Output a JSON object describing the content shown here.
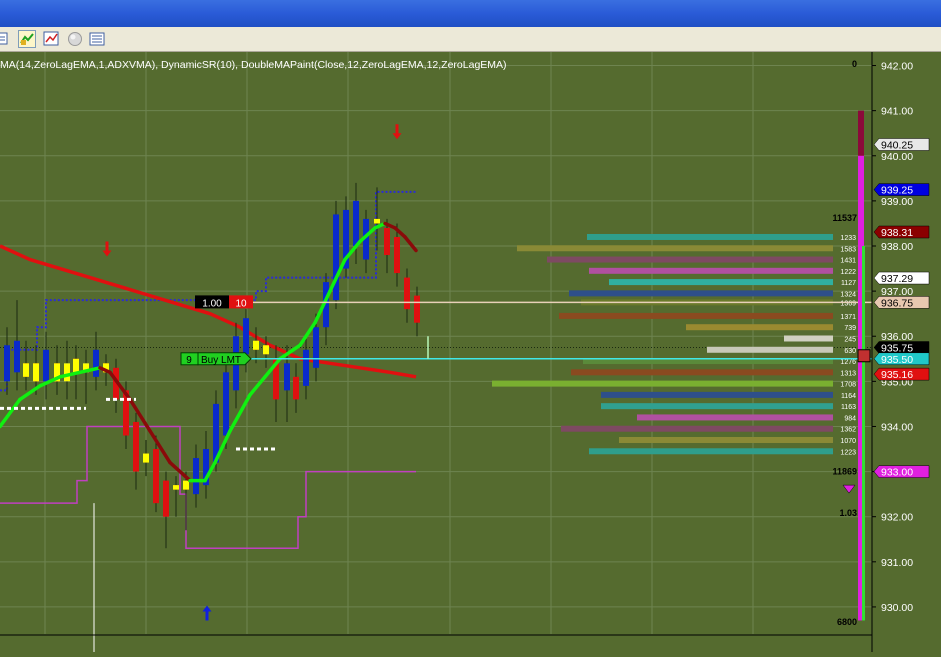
{
  "indicators_label": "MA(14,ZeroLagEMA,1,ADXVMA), DynamicSR(10), DoubleMAPaint(Close,12,ZeroLagEMA,12,ZeroLagEMA)",
  "colors": {
    "background": "#556b2f",
    "grid": "#6e8450",
    "bull": "#0a2acc",
    "bear": "#e01010",
    "doji": "#ffff00",
    "ma_up": "#10f010",
    "ma_down": "#8a0a0a",
    "slow_ma": "#e01010",
    "resistance": "#2a2ad8",
    "support": "#c040c0"
  },
  "chart_data": {
    "type": "candlestick",
    "ylim": [
      929.4,
      942.3
    ],
    "y_ticks": [
      "942.00",
      "941.00",
      "940.00",
      "939.00",
      "938.00",
      "937.00",
      "936.00",
      "935.00",
      "934.00",
      "933.00",
      "932.00",
      "931.00",
      "930.00"
    ],
    "y_tick_values": [
      942,
      941,
      940,
      939,
      938,
      937,
      936,
      935,
      934,
      933,
      932,
      931,
      930
    ],
    "price_flags": [
      {
        "label": "940.25",
        "value": 940.25,
        "bg": "#e8e8e8",
        "fg": "#000000"
      },
      {
        "label": "939.25",
        "value": 939.25,
        "bg": "#0000e0",
        "fg": "#ffffff"
      },
      {
        "label": "938.31",
        "value": 938.31,
        "bg": "#8b0000",
        "fg": "#ffffff"
      },
      {
        "label": "937.29",
        "value": 937.29,
        "bg": "#ffffff",
        "fg": "#000000"
      },
      {
        "label": "936.75",
        "value": 936.75,
        "bg": "#e8c8b0",
        "fg": "#000000"
      },
      {
        "label": "935.75",
        "value": 935.75,
        "bg": "#000000",
        "fg": "#ffffff"
      },
      {
        "label": "935.50",
        "value": 935.5,
        "bg": "#20c8c8",
        "fg": "#ffffff"
      },
      {
        "label": "935.16",
        "value": 935.16,
        "bg": "#e01010",
        "fg": "#ffffff"
      },
      {
        "label": "933.00",
        "value": 933.0,
        "bg": "#e020e0",
        "fg": "#ffffff"
      }
    ],
    "candles": [
      {
        "x": 7,
        "o": 935.0,
        "c": 935.8,
        "h": 936.2,
        "l": 934.7
      },
      {
        "x": 17,
        "o": 935.2,
        "c": 935.9,
        "h": 936.8,
        "l": 934.8
      },
      {
        "x": 26,
        "o": 935.4,
        "c": 935.1,
        "h": 935.9,
        "l": 934.8
      },
      {
        "x": 36,
        "o": 935.4,
        "c": 935.0,
        "h": 935.8,
        "l": 934.7
      },
      {
        "x": 46,
        "o": 935.0,
        "c": 935.7,
        "h": 936.1,
        "l": 934.6
      },
      {
        "x": 57,
        "o": 935.4,
        "c": 935.0,
        "h": 935.8,
        "l": 934.7
      },
      {
        "x": 67,
        "o": 935.0,
        "c": 935.4,
        "h": 935.9,
        "l": 934.6
      },
      {
        "x": 76,
        "o": 935.5,
        "c": 935.2,
        "h": 935.8,
        "l": 934.6
      },
      {
        "x": 86,
        "o": 935.2,
        "c": 935.4,
        "h": 935.7,
        "l": 934.5
      },
      {
        "x": 96,
        "o": 935.1,
        "c": 935.7,
        "h": 936.1,
        "l": 934.8
      },
      {
        "x": 106,
        "o": 935.4,
        "c": 935.2,
        "h": 935.6,
        "l": 934.9
      },
      {
        "x": 116,
        "o": 935.3,
        "c": 934.6,
        "h": 935.5,
        "l": 934.3
      },
      {
        "x": 126,
        "o": 934.8,
        "c": 933.8,
        "h": 935.0,
        "l": 933.5
      },
      {
        "x": 136,
        "o": 934.1,
        "c": 933.0,
        "h": 934.3,
        "l": 932.6
      },
      {
        "x": 146,
        "o": 933.4,
        "c": 933.2,
        "h": 933.7,
        "l": 932.9
      },
      {
        "x": 156,
        "o": 933.5,
        "c": 932.3,
        "h": 933.8,
        "l": 932.1
      },
      {
        "x": 166,
        "o": 932.8,
        "c": 932.0,
        "h": 933.0,
        "l": 931.3
      },
      {
        "x": 176,
        "o": 932.7,
        "c": 932.6,
        "h": 932.9,
        "l": 932.0
      },
      {
        "x": 186,
        "o": 932.8,
        "c": 932.6,
        "h": 933.0,
        "l": 931.7
      },
      {
        "x": 196,
        "o": 932.5,
        "c": 933.3,
        "h": 933.6,
        "l": 932.2
      },
      {
        "x": 206,
        "o": 932.7,
        "c": 933.5,
        "h": 933.9,
        "l": 932.4
      },
      {
        "x": 216,
        "o": 933.2,
        "c": 934.5,
        "h": 934.8,
        "l": 933.0
      },
      {
        "x": 226,
        "o": 933.8,
        "c": 935.2,
        "h": 935.4,
        "l": 933.5
      },
      {
        "x": 236,
        "o": 934.8,
        "c": 936.0,
        "h": 936.3,
        "l": 934.4
      },
      {
        "x": 246,
        "o": 935.6,
        "c": 936.4,
        "h": 936.6,
        "l": 935.2
      },
      {
        "x": 256,
        "o": 935.9,
        "c": 935.7,
        "h": 936.2,
        "l": 935.4
      },
      {
        "x": 266,
        "o": 935.8,
        "c": 935.6,
        "h": 936.0,
        "l": 935.3
      },
      {
        "x": 276,
        "o": 935.5,
        "c": 934.6,
        "h": 935.8,
        "l": 934.1
      },
      {
        "x": 287,
        "o": 934.8,
        "c": 935.4,
        "h": 935.8,
        "l": 934.1
      },
      {
        "x": 296,
        "o": 935.1,
        "c": 934.6,
        "h": 935.4,
        "l": 934.3
      },
      {
        "x": 306,
        "o": 934.9,
        "c": 935.7,
        "h": 936.0,
        "l": 934.6
      },
      {
        "x": 316,
        "o": 935.3,
        "c": 936.2,
        "h": 936.5,
        "l": 935.0
      },
      {
        "x": 326,
        "o": 936.2,
        "c": 937.2,
        "h": 937.4,
        "l": 935.8
      },
      {
        "x": 336,
        "o": 936.8,
        "c": 938.7,
        "h": 939.0,
        "l": 936.6
      },
      {
        "x": 346,
        "o": 937.5,
        "c": 938.8,
        "h": 939.1,
        "l": 937.3
      },
      {
        "x": 356,
        "o": 938.0,
        "c": 939.0,
        "h": 939.4,
        "l": 937.6
      },
      {
        "x": 366,
        "o": 937.7,
        "c": 938.6,
        "h": 938.8,
        "l": 937.4
      },
      {
        "x": 377,
        "o": 938.6,
        "c": 938.5,
        "h": 939.3,
        "l": 937.9
      },
      {
        "x": 387,
        "o": 938.4,
        "c": 937.8,
        "h": 938.6,
        "l": 937.4
      },
      {
        "x": 397,
        "o": 938.2,
        "c": 937.4,
        "h": 938.5,
        "l": 937.1
      },
      {
        "x": 407,
        "o": 937.3,
        "c": 936.6,
        "h": 937.5,
        "l": 936.3
      },
      {
        "x": 417,
        "o": 936.9,
        "c": 936.3,
        "h": 937.1,
        "l": 936.0
      }
    ],
    "fast_ma": [
      [
        0,
        934.0
      ],
      [
        20,
        934.6
      ],
      [
        40,
        934.9
      ],
      [
        60,
        935.1
      ],
      [
        80,
        935.2
      ],
      [
        100,
        935.3
      ],
      [
        110,
        935.2
      ],
      [
        130,
        934.6
      ],
      [
        150,
        933.9
      ],
      [
        170,
        933.2
      ],
      [
        190,
        932.8
      ],
      [
        205,
        932.8
      ],
      [
        215,
        933.2
      ],
      [
        230,
        933.9
      ],
      [
        250,
        934.7
      ],
      [
        265,
        935.1
      ],
      [
        280,
        935.5
      ],
      [
        300,
        935.8
      ],
      [
        315,
        936.3
      ],
      [
        330,
        937.0
      ],
      [
        345,
        937.7
      ],
      [
        360,
        938.1
      ],
      [
        375,
        938.4
      ],
      [
        385,
        938.5
      ],
      [
        395,
        938.4
      ],
      [
        405,
        938.2
      ],
      [
        416,
        937.9
      ]
    ],
    "slow_ma": [
      [
        0,
        938.0
      ],
      [
        30,
        937.7
      ],
      [
        60,
        937.5
      ],
      [
        90,
        937.3
      ],
      [
        120,
        937.1
      ],
      [
        150,
        936.9
      ],
      [
        180,
        936.7
      ],
      [
        210,
        936.5
      ],
      [
        240,
        936.2
      ],
      [
        270,
        935.8
      ],
      [
        300,
        935.5
      ],
      [
        330,
        935.4
      ],
      [
        360,
        935.3
      ],
      [
        390,
        935.2
      ],
      [
        416,
        935.1
      ]
    ],
    "resistance": [
      [
        0,
        934.8
      ],
      [
        7,
        934.8
      ],
      [
        7,
        935.7
      ],
      [
        37,
        935.7
      ],
      [
        37,
        936.2
      ],
      [
        46,
        936.2
      ],
      [
        46,
        936.8
      ],
      [
        106,
        936.8
      ],
      [
        106,
        936.8
      ],
      [
        176,
        936.8
      ],
      [
        176,
        936.8
      ],
      [
        256,
        936.8
      ],
      [
        256,
        937.0
      ],
      [
        266,
        937.0
      ],
      [
        266,
        937.3
      ],
      [
        376,
        937.3
      ],
      [
        376,
        939.2
      ],
      [
        416,
        939.2
      ]
    ],
    "support": [
      [
        0,
        932.3
      ],
      [
        77,
        932.3
      ],
      [
        77,
        932.8
      ],
      [
        87,
        932.8
      ],
      [
        87,
        934.0
      ],
      [
        180,
        934.0
      ],
      [
        180,
        932.5
      ],
      [
        186,
        932.5
      ],
      [
        186,
        931.3
      ],
      [
        298,
        931.3
      ],
      [
        298,
        932.0
      ],
      [
        306,
        932.0
      ],
      [
        306,
        933.0
      ],
      [
        416,
        933.0
      ]
    ],
    "swing_lows": [
      {
        "x1": 0,
        "x2": 86,
        "y": 934.4
      },
      {
        "x1": 106,
        "x2": 136,
        "y": 934.6
      },
      {
        "x1": 236,
        "x2": 276,
        "y": 933.5
      }
    ],
    "arrows": [
      {
        "x": 107,
        "y": 937.9,
        "dir": "down",
        "color": "#e01010"
      },
      {
        "x": 397,
        "y": 940.5,
        "dir": "down",
        "color": "#e01010"
      },
      {
        "x": 207,
        "y": 929.9,
        "dir": "up",
        "color": "#1020e0"
      }
    ],
    "volume_profile": [
      {
        "price": 938.2,
        "label": "1233",
        "width": 246,
        "color": "#2f9e8c"
      },
      {
        "price": 937.95,
        "label": "1583",
        "width": 316,
        "color": "#8a8a36"
      },
      {
        "price": 937.7,
        "label": "1431",
        "width": 286,
        "color": "#7e4a62"
      },
      {
        "price": 937.45,
        "label": "1222",
        "width": 244,
        "color": "#b050a0"
      },
      {
        "price": 937.2,
        "label": "1127",
        "width": 224,
        "color": "#30b0a0"
      },
      {
        "price": 936.95,
        "label": "1324",
        "width": 264,
        "color": "#2e4f8a"
      },
      {
        "price": 936.75,
        "label": "1369",
        "width": 252,
        "color": "#6a7a2a"
      },
      {
        "price": 936.45,
        "label": "1371",
        "width": 274,
        "color": "#8a4a20"
      },
      {
        "price": 936.2,
        "label": "739",
        "width": 147,
        "color": "#9a8a30"
      },
      {
        "price": 935.95,
        "label": "245",
        "width": 49,
        "color": "#d0d0c0"
      },
      {
        "price": 935.7,
        "label": "630",
        "width": 126,
        "color": "#c8c8b8"
      },
      {
        "price": 935.45,
        "label": "1276",
        "width": 250,
        "color": "#5a8a3a"
      },
      {
        "price": 935.2,
        "label": "1313",
        "width": 262,
        "color": "#8a4a20"
      },
      {
        "price": 934.95,
        "label": "1708",
        "width": 341,
        "color": "#7ab030"
      },
      {
        "price": 934.7,
        "label": "1164",
        "width": 232,
        "color": "#2e4f8a"
      },
      {
        "price": 934.45,
        "label": "1163",
        "width": 232,
        "color": "#30a090"
      },
      {
        "price": 934.2,
        "label": "984",
        "width": 196,
        "color": "#b050a0"
      },
      {
        "price": 933.95,
        "label": "1362",
        "width": 272,
        "color": "#7e4a62"
      },
      {
        "price": 933.7,
        "label": "1070",
        "width": 214,
        "color": "#8a8a36"
      },
      {
        "price": 933.45,
        "label": "1223",
        "width": 244,
        "color": "#2f9e8c"
      }
    ],
    "pointer_price": 935.5,
    "last_price": 935.75,
    "side_labels": {
      "top": "0",
      "upper_count": "11537",
      "lower_count": "11869",
      "ratio": "1.03",
      "bottom": "6800"
    },
    "orders": {
      "position_qty": "1.00",
      "position_val": "10",
      "position_price": 936.75,
      "order_qty": "9",
      "order_label": "Buy LMT",
      "order_price": 935.5
    }
  }
}
